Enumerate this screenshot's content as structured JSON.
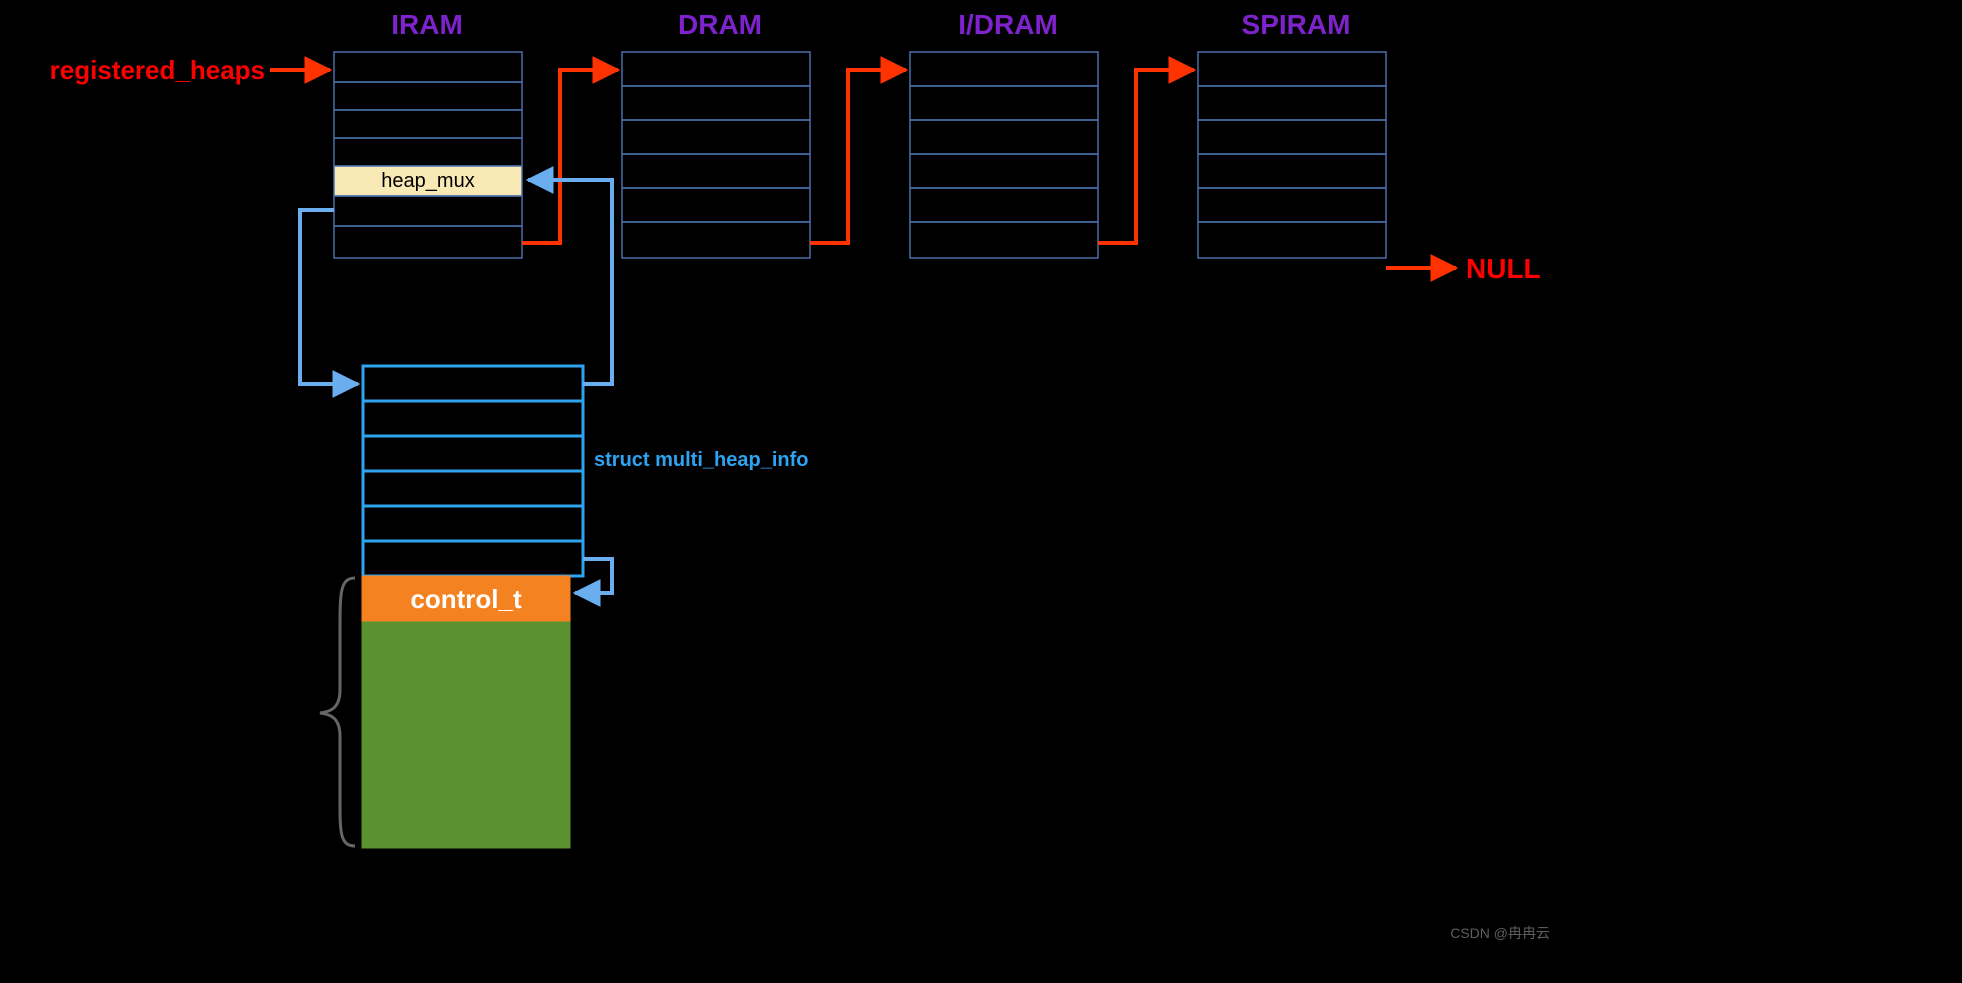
{
  "headers": {
    "iram": "IRAM",
    "dram": "DRAM",
    "idram": "I/DRAM",
    "spiram": "SPIRAM"
  },
  "labels": {
    "registered_heaps": "registered_heaps",
    "heap_mux": "heap_mux",
    "multi_heap_info": "struct multi_heap_info",
    "control_t": "control_t",
    "null": "NULL"
  },
  "watermark": "CSDN @冉冉云"
}
